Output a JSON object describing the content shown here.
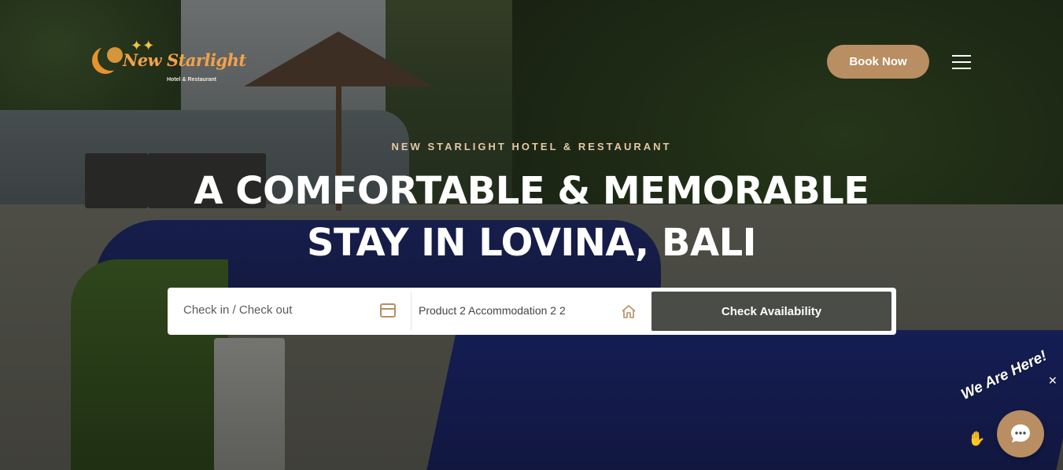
{
  "brand": {
    "logo_script": "New Starlight",
    "logo_sub": "Hotel & Restaurant"
  },
  "header": {
    "book_label": "Book Now"
  },
  "hero": {
    "eyebrow": "NEW STARLIGHT HOTEL & RESTAURANT",
    "title_line1": "A COMFORTABLE & MEMORABLE",
    "title_line2": "STAY IN LOVINA, BALI"
  },
  "search": {
    "dates_placeholder": "Check in / Check out",
    "product_value": "Product 2 Accommodation 2 2",
    "submit_label": "Check Availability"
  },
  "chat": {
    "label": "We Are Here!"
  },
  "colors": {
    "accent": "#b88e62",
    "button_dark": "#4a4d47",
    "eyebrow": "#e2c9a3"
  },
  "icons": [
    "calendar-icon",
    "home-icon",
    "hamburger-menu-icon",
    "chat-bubble-icon",
    "waving-hand-icon",
    "close-icon"
  ]
}
